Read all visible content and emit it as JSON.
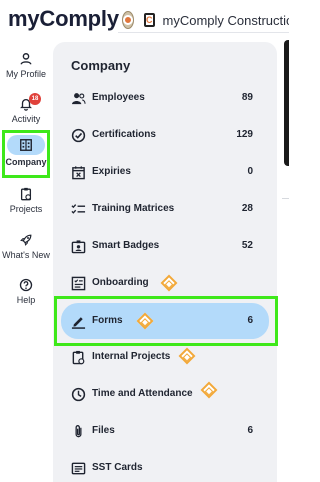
{
  "app": {
    "logo_text": "myComply",
    "org_name": "myComply Construction",
    "org_logo_letter": "C"
  },
  "nav": {
    "items": [
      {
        "id": "my-profile",
        "label": "My Profile"
      },
      {
        "id": "activity",
        "label": "Activity",
        "badge": "18"
      },
      {
        "id": "company",
        "label": "Company",
        "active": true
      },
      {
        "id": "projects",
        "label": "Projects"
      },
      {
        "id": "whats-new",
        "label": "What's New"
      },
      {
        "id": "help",
        "label": "Help"
      }
    ]
  },
  "panel": {
    "title": "Company",
    "items": [
      {
        "label": "Employees",
        "count": "89",
        "icon": "users-icon"
      },
      {
        "label": "Certifications",
        "count": "129",
        "icon": "check-circle-icon"
      },
      {
        "label": "Expiries",
        "count": "0",
        "icon": "calendar-x-icon"
      },
      {
        "label": "Training Matrices",
        "count": "28",
        "icon": "checklist-icon"
      },
      {
        "label": "Smart Badges",
        "count": "52",
        "icon": "badge-icon"
      },
      {
        "label": "Onboarding",
        "count": "",
        "icon": "onboarding-icon",
        "marker": true
      },
      {
        "label": "Forms",
        "count": "6",
        "icon": "pen-icon",
        "marker": true,
        "active": true
      },
      {
        "label": "Internal Projects",
        "count": "",
        "icon": "clipboard-icon",
        "marker": true
      },
      {
        "label": "Time and Attendance",
        "count": "",
        "icon": "clock-icon",
        "marker": true
      },
      {
        "label": "Files",
        "count": "6",
        "icon": "paperclip-icon"
      },
      {
        "label": "SST Cards",
        "count": "",
        "icon": "id-card-icon"
      }
    ]
  },
  "colors": {
    "active_bg": "#b3dafa",
    "panel_bg": "#f0f1f4",
    "badge": "#e0413a",
    "marker": "#f2a93a",
    "highlight": "#3ee81a"
  }
}
